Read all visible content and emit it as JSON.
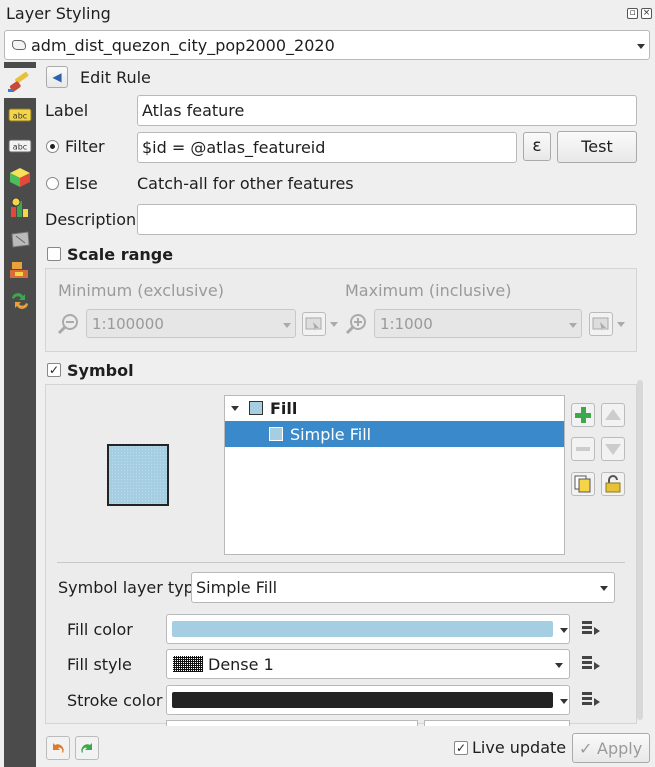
{
  "window": {
    "title": "Layer Styling"
  },
  "layer_selector": {
    "value": "adm_dist_quezon_city_pop2000_2020"
  },
  "dock_icons": [
    "paintbrush-icon",
    "labels-icon",
    "masks-icon",
    "3d-view-icon",
    "diagrams-icon",
    "fields-icon",
    "history-icon",
    "rendering-icon"
  ],
  "header": {
    "back_label": "◀",
    "title": "Edit Rule"
  },
  "rule": {
    "label_caption": "Label",
    "label_value": "Atlas feature",
    "filter_caption": "Filter",
    "filter_value": "$id = @atlas_featureid",
    "expression_symbol": "ε",
    "test_label": "Test",
    "else_caption": "Else",
    "else_text": "Catch-all for other features",
    "description_caption": "Description",
    "description_value": ""
  },
  "scale_range": {
    "title": "Scale range",
    "checked": false,
    "min_caption": "Minimum (exclusive)",
    "max_caption": "Maximum (inclusive)",
    "min_value": "1:100000",
    "max_value": "1:1000"
  },
  "symbol": {
    "title": "Symbol",
    "checked": true,
    "preview_color": "#a6cee3",
    "tree": [
      {
        "label": "Fill",
        "level": 0,
        "bold": true
      },
      {
        "label": "Simple Fill",
        "level": 1,
        "selected": true
      }
    ],
    "layer_type_caption": "Symbol layer type",
    "layer_type_value": "Simple Fill",
    "fill_color_caption": "Fill color",
    "fill_color": "#a6cee3",
    "fill_style_caption": "Fill style",
    "fill_style_value": "Dense 1",
    "stroke_color_caption": "Stroke color",
    "stroke_color": "#232323"
  },
  "footer": {
    "live_update_label": "Live update",
    "live_update_checked": true,
    "apply_label": "Apply"
  },
  "colors": {
    "accent": "#3a8acb",
    "dock": "#4b4b4b"
  }
}
